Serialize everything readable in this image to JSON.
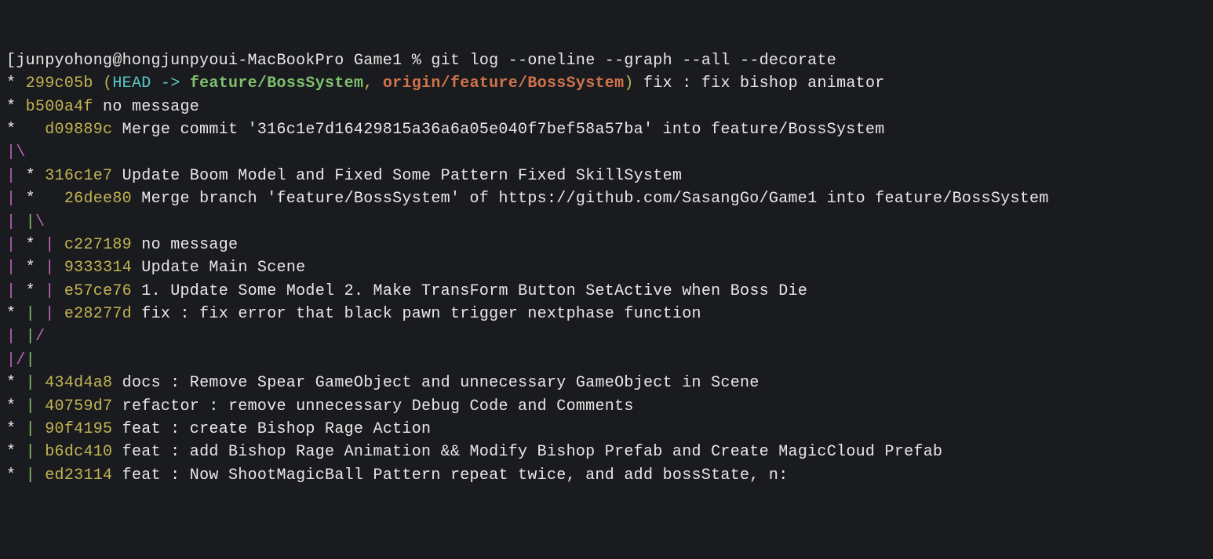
{
  "prompt": {
    "bracket": "[",
    "user_host": "junpyohong@hongjunpyoui-MacBookPro",
    "dir": "Game1",
    "pct": "%",
    "command": "git log --oneline --graph --all --decorate"
  },
  "lines": [
    {
      "graph": [
        {
          "t": "*",
          "c": "star"
        },
        {
          "t": " ",
          "c": "msg"
        }
      ],
      "hash": "299c05b",
      "decor": {
        "open": "(",
        "head": "HEAD",
        "arrow": " -> ",
        "b1": "feature/BossSystem",
        "comma": ", ",
        "b2": "origin/feature/BossSystem",
        "close": ")"
      },
      "msg": " fix : fix bishop animator"
    },
    {
      "graph": [
        {
          "t": "*",
          "c": "star"
        },
        {
          "t": " ",
          "c": "msg"
        }
      ],
      "hash": "b500a4f",
      "msg": " no message"
    },
    {
      "graph": [
        {
          "t": "*",
          "c": "star"
        },
        {
          "t": "   ",
          "c": "msg"
        }
      ],
      "hash": "d09889c",
      "msg": " Merge commit '316c1e7d16429815a36a6a05e040f7bef58a57ba' into feature/BossSystem"
    },
    {
      "graph": [
        {
          "t": "|",
          "c": "pipe-magenta"
        },
        {
          "t": "\\",
          "c": "backslash-magenta"
        }
      ]
    },
    {
      "graph": [
        {
          "t": "|",
          "c": "pipe-magenta"
        },
        {
          "t": " ",
          "c": "msg"
        },
        {
          "t": "*",
          "c": "star"
        },
        {
          "t": " ",
          "c": "msg"
        }
      ],
      "hash": "316c1e7",
      "msg": " Update Boom Model and Fixed Some Pattern Fixed SkillSystem"
    },
    {
      "graph": [
        {
          "t": "|",
          "c": "pipe-magenta"
        },
        {
          "t": " ",
          "c": "msg"
        },
        {
          "t": "*",
          "c": "star"
        },
        {
          "t": "   ",
          "c": "msg"
        }
      ],
      "hash": "26dee80",
      "msg": " Merge branch 'feature/BossSystem' of https://github.com/SasangGo/Game1 into feature/BossSystem"
    },
    {
      "graph": [
        {
          "t": "|",
          "c": "pipe-magenta"
        },
        {
          "t": " ",
          "c": "msg"
        },
        {
          "t": "|",
          "c": "pipe-green"
        },
        {
          "t": "\\",
          "c": "backslash-magenta"
        }
      ]
    },
    {
      "graph": [
        {
          "t": "|",
          "c": "pipe-magenta"
        },
        {
          "t": " ",
          "c": "msg"
        },
        {
          "t": "*",
          "c": "star"
        },
        {
          "t": " ",
          "c": "msg"
        },
        {
          "t": "|",
          "c": "pipe-magenta"
        },
        {
          "t": " ",
          "c": "msg"
        }
      ],
      "hash": "c227189",
      "msg": " no message"
    },
    {
      "graph": [
        {
          "t": "|",
          "c": "pipe-magenta"
        },
        {
          "t": " ",
          "c": "msg"
        },
        {
          "t": "*",
          "c": "star"
        },
        {
          "t": " ",
          "c": "msg"
        },
        {
          "t": "|",
          "c": "pipe-magenta"
        },
        {
          "t": " ",
          "c": "msg"
        }
      ],
      "hash": "9333314",
      "msg": " Update Main Scene"
    },
    {
      "graph": [
        {
          "t": "|",
          "c": "pipe-magenta"
        },
        {
          "t": " ",
          "c": "msg"
        },
        {
          "t": "*",
          "c": "star"
        },
        {
          "t": " ",
          "c": "msg"
        },
        {
          "t": "|",
          "c": "pipe-magenta"
        },
        {
          "t": " ",
          "c": "msg"
        }
      ],
      "hash": "e57ce76",
      "msg": " 1. Update Some Model 2. Make TransForm Button SetActive when Boss Die"
    },
    {
      "graph": [
        {
          "t": "*",
          "c": "star"
        },
        {
          "t": " ",
          "c": "msg"
        },
        {
          "t": "|",
          "c": "pipe-green"
        },
        {
          "t": " ",
          "c": "msg"
        },
        {
          "t": "|",
          "c": "pipe-magenta"
        },
        {
          "t": " ",
          "c": "msg"
        }
      ],
      "hash": "e28277d",
      "msg": " fix : fix error that black pawn trigger nextphase function"
    },
    {
      "graph": [
        {
          "t": "|",
          "c": "pipe-magenta"
        },
        {
          "t": " ",
          "c": "msg"
        },
        {
          "t": "|",
          "c": "pipe-green"
        },
        {
          "t": "/",
          "c": "slash-magenta"
        }
      ]
    },
    {
      "graph": [
        {
          "t": "|",
          "c": "pipe-magenta"
        },
        {
          "t": "/",
          "c": "slash-magenta"
        },
        {
          "t": "|",
          "c": "pipe-green"
        }
      ]
    },
    {
      "graph": [
        {
          "t": "*",
          "c": "star"
        },
        {
          "t": " ",
          "c": "msg"
        },
        {
          "t": "|",
          "c": "pipe-green"
        },
        {
          "t": " ",
          "c": "msg"
        }
      ],
      "hash": "434d4a8",
      "msg": " docs : Remove Spear GameObject and unnecessary GameObject in Scene"
    },
    {
      "graph": [
        {
          "t": "*",
          "c": "star"
        },
        {
          "t": " ",
          "c": "msg"
        },
        {
          "t": "|",
          "c": "pipe-green"
        },
        {
          "t": " ",
          "c": "msg"
        }
      ],
      "hash": "40759d7",
      "msg": " refactor : remove unnecessary Debug Code and Comments"
    },
    {
      "graph": [
        {
          "t": "*",
          "c": "star"
        },
        {
          "t": " ",
          "c": "msg"
        },
        {
          "t": "|",
          "c": "pipe-green"
        },
        {
          "t": " ",
          "c": "msg"
        }
      ],
      "hash": "90f4195",
      "msg": " feat : create Bishop Rage Action"
    },
    {
      "graph": [
        {
          "t": "*",
          "c": "star"
        },
        {
          "t": " ",
          "c": "msg"
        },
        {
          "t": "|",
          "c": "pipe-green"
        },
        {
          "t": " ",
          "c": "msg"
        }
      ],
      "hash": "b6dc410",
      "msg": " feat : add Bishop Rage Animation && Modify Bishop Prefab and Create MagicCloud Prefab"
    },
    {
      "graph": [
        {
          "t": "*",
          "c": "star"
        },
        {
          "t": " ",
          "c": "msg"
        },
        {
          "t": "|",
          "c": "pipe-green"
        },
        {
          "t": " ",
          "c": "msg"
        }
      ],
      "hash": "ed23114",
      "msg": " feat : Now ShootMagicBall Pattern repeat twice, and add bossState, n:"
    }
  ]
}
